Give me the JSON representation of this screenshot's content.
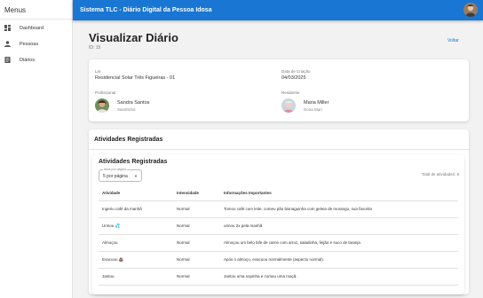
{
  "sidebar": {
    "title": "Menus",
    "items": [
      {
        "label": "Dashboard",
        "icon": "dashboard-icon"
      },
      {
        "label": "Pessoas",
        "icon": "person-icon"
      },
      {
        "label": "Diários",
        "icon": "notebook-icon"
      }
    ]
  },
  "appbar": {
    "title": "Sistema TLC - Diário Digital da Pessoa Idosa"
  },
  "page": {
    "title": "Visualizar Diário",
    "id": "ID: 15",
    "back": "Voltar"
  },
  "info": {
    "lar_label": "Lar",
    "lar_value": "Residencial Solar Três Figueiras - 01",
    "date_label": "Data de Criação",
    "date_value": "04/03/2025",
    "professional_label": "Profissional",
    "professional_name": "Sandra Santos",
    "professional_nick": "Sandrinha",
    "resident_label": "Residente",
    "resident_name": "Maria Miller",
    "resident_nick": "Dona Mari"
  },
  "activities": {
    "section_title": "Atividades Registradas",
    "inner_title": "Atividades Registradas",
    "select_label": "Itens por página",
    "select_value": "5 por página",
    "total": "Total de atividades: 5",
    "headers": [
      "Atividade",
      "Intensidade",
      "Informações Importantes"
    ],
    "rows": [
      {
        "activity": "Ingeriu café da manhã",
        "intensity": "Normal",
        "info": "Tomou café com leite, comeu pão bisnaguinha com geleia de morango, sua favorita"
      },
      {
        "activity": "Urinou 💦",
        "intensity": "Normal",
        "info": "urinou 2x pela manhã"
      },
      {
        "activity": "Almoçou",
        "intensity": "Normal",
        "info": "Almoçou um belo bife de carne com arroz, saladinha, feijão e suco de laranja"
      },
      {
        "activity": "Evacuou 💩",
        "intensity": "Normal",
        "info": "Após o almoço, evacuou normalmente (aspecto normal)."
      },
      {
        "activity": "Jantou",
        "intensity": "Normal",
        "info": "Jantou uma sopinha e comeu uma maçã."
      }
    ]
  },
  "colors": {
    "primary": "#1976d2",
    "background": "#f2f2f2"
  }
}
